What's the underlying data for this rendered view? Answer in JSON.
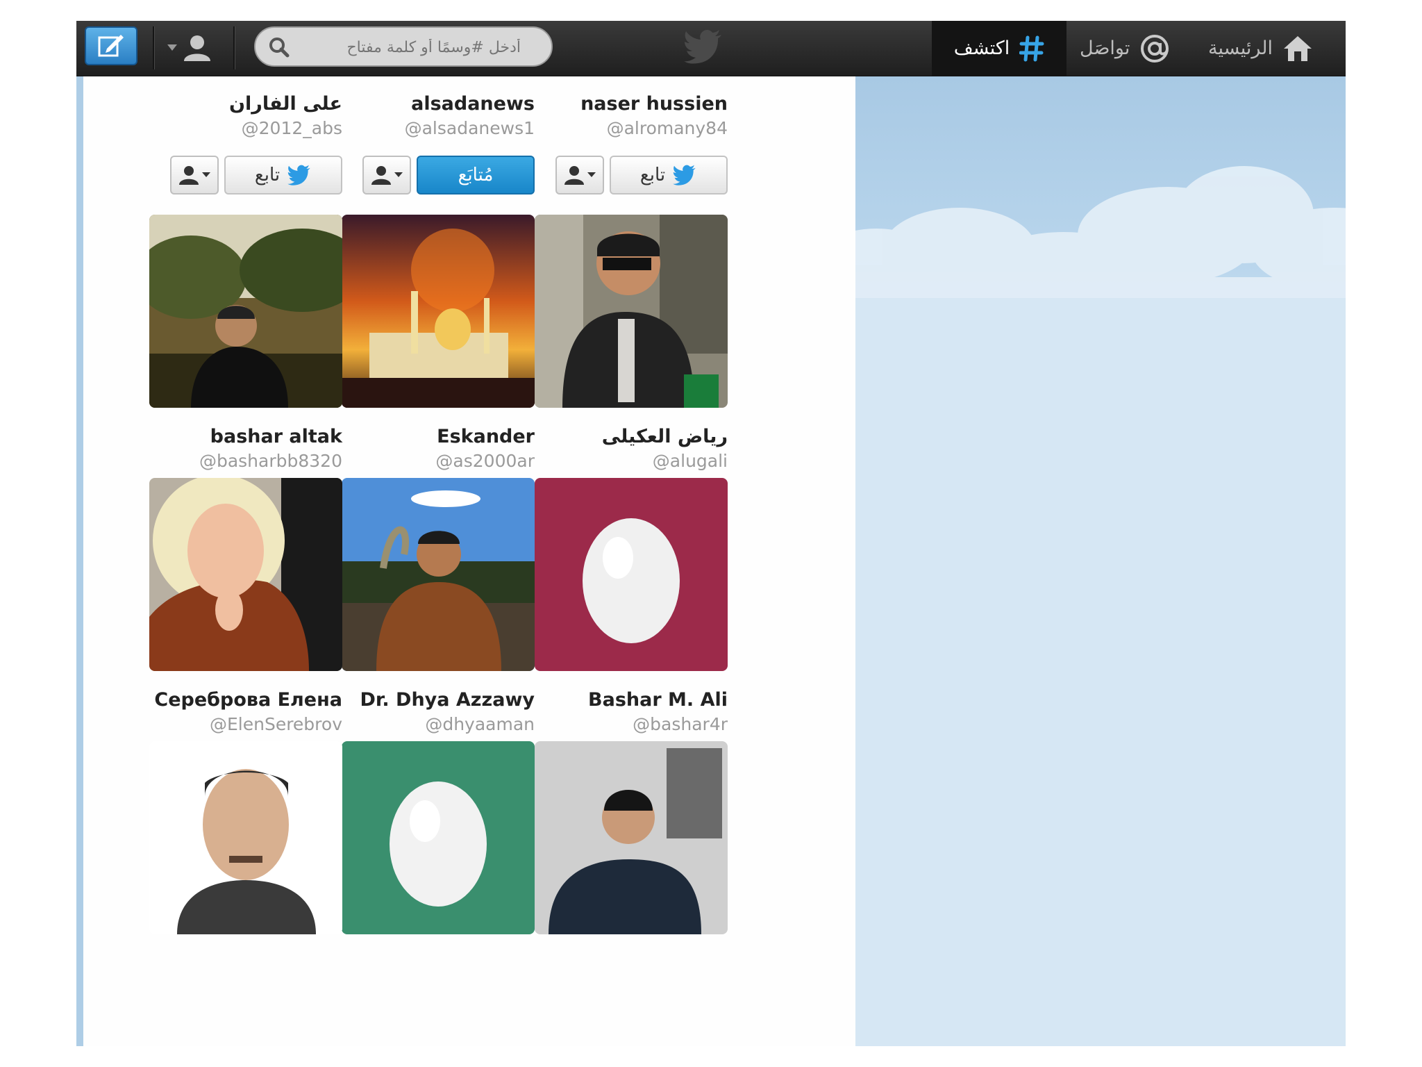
{
  "topbar": {
    "nav": [
      {
        "label": "الرئيسية",
        "icon": "home-icon"
      },
      {
        "label": "تواصَل",
        "icon": "at-sign-icon"
      },
      {
        "label": "اكتشف",
        "icon": "hashtag-icon"
      }
    ],
    "search_placeholder": "أدخل #وسمًا أو كلمة مفتاح",
    "logo_icon": "twitter-bird-icon",
    "compose_icon": "compose-icon",
    "me_icon": "user-icon"
  },
  "follow_label": "تابع",
  "following_label": "مُتابَع",
  "colors": {
    "topbar": "#2b2b2b",
    "following_blue": "#1d8fd2",
    "egg_green": "#3a8f6e",
    "egg_maroon": "#9c2a4a",
    "sky": "#b8d5ec"
  },
  "cards": [
    {
      "name": "naser hussien",
      "handle": "@alromany84",
      "following": false,
      "avatar": "egg-green"
    },
    {
      "name": "alsadanews",
      "handle": "@alsadanews1",
      "following": true,
      "avatar": "banner-red"
    },
    {
      "name": "على الفاران",
      "handle": "@2012_abs",
      "following": false,
      "avatar": "egg-green"
    },
    {
      "name": "رياض العكيلى",
      "handle": "@alugali",
      "following": true,
      "avatar": "photo-man-sunglasses"
    },
    {
      "name": "Eskander",
      "handle": "@as2000ar",
      "following": false,
      "avatar": "photo-mosque-fire"
    },
    {
      "name": "bashar altak",
      "handle": "@basharbb8320",
      "following": false,
      "avatar": "photo-man-trees"
    },
    {
      "name": "Bashar M. Ali",
      "handle": "@bashar4r",
      "following": true,
      "avatar": "egg-maroon"
    },
    {
      "name": "Dr. Dhya Azzawy",
      "handle": "@dhyaaman",
      "following": true,
      "avatar": "photo-man-snake"
    },
    {
      "name": "Сереброва Елена",
      "handle": "@ElenSerebrov",
      "following": true,
      "avatar": "photo-woman-blonde"
    },
    {
      "name": "",
      "handle": "",
      "following": false,
      "avatar": "photo-man-ruins"
    },
    {
      "name": "",
      "handle": "",
      "following": false,
      "avatar": "egg-green"
    },
    {
      "name": "",
      "handle": "",
      "following": false,
      "avatar": "photo-man-portrait"
    }
  ]
}
